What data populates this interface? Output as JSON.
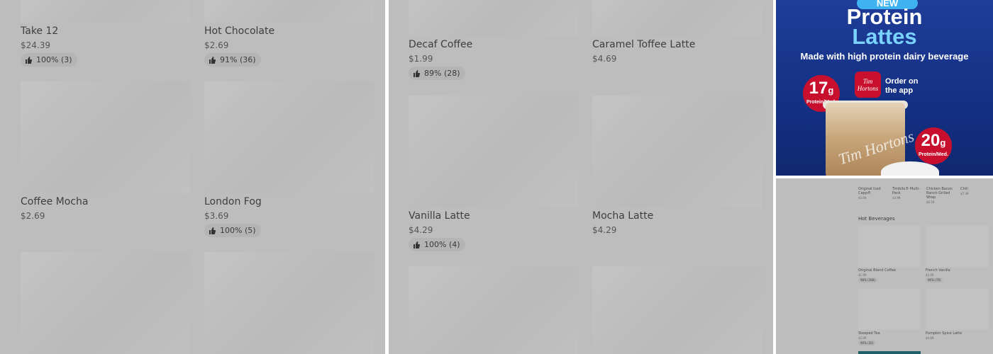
{
  "panel1": {
    "items": [
      {
        "name": "Take 12",
        "price": "$24.39",
        "rating": "100% (3)"
      },
      {
        "name": "Hot Chocolate",
        "price": "$2.69",
        "rating": "91% (36)"
      },
      {
        "name": "Coffee Mocha",
        "price": "$2.69",
        "rating": ""
      },
      {
        "name": "London Fog",
        "price": "$3.69",
        "rating": "100% (5)"
      },
      {
        "name": "",
        "price": "",
        "rating": ""
      },
      {
        "name": "",
        "price": "",
        "rating": ""
      }
    ]
  },
  "panel2": {
    "items": [
      {
        "name": "Decaf Coffee",
        "price": "$1.99",
        "rating": "89% (28)"
      },
      {
        "name": "Caramel Toffee Latte",
        "price": "$4.69",
        "rating": ""
      },
      {
        "name": "Vanilla Latte",
        "price": "$4.29",
        "rating": "100% (4)"
      },
      {
        "name": "Mocha Latte",
        "price": "$4.29",
        "rating": ""
      },
      {
        "name": "",
        "price": "",
        "rating": ""
      },
      {
        "name": "",
        "price": "",
        "rating": ""
      }
    ]
  },
  "promo": {
    "new_tag": "NEW",
    "title_line1": "Protein",
    "title_line2": "Lattes",
    "subtitle": "Made with high protein dairy beverage",
    "badge_left_num": "17",
    "badge_left_unit": "g",
    "badge_left_label": "Protein/Med.",
    "badge_right_num": "20",
    "badge_right_unit": "g",
    "badge_right_label": "Protein/Med.",
    "app_logo_text": "Tim Hortons",
    "order_line1": "Order on",
    "order_line2": "the app",
    "cup_text": "Tim Hortons",
    "brand_color": "#c8102e",
    "background_color": "#143083"
  },
  "mini": {
    "top_items": [
      {
        "name": "Original Iced Capp®",
        "price": "$3.69"
      },
      {
        "name": "Timbits® Multi-Pack",
        "price": "$3.99"
      },
      {
        "name": "Chicken Bacon Ranch Grilled Wrap",
        "price": "$6.59"
      },
      {
        "name": "Chili",
        "price": "$7.39"
      }
    ],
    "section_title": "Hot Beverages",
    "grid": [
      {
        "name": "Original Blend Coffee",
        "price": "$1.99",
        "rating": "98% (388)"
      },
      {
        "name": "French Vanilla",
        "price": "$3.09",
        "rating": "96% (79)"
      },
      {
        "name": "Steeped Tea",
        "price": "$2.09",
        "rating": "90% (30)"
      },
      {
        "name": "Pumpkin Spice Latte",
        "price": "$4.69",
        "rating": ""
      }
    ]
  }
}
